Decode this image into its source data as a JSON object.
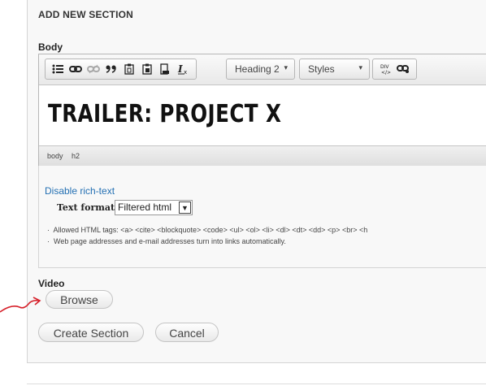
{
  "section": {
    "title": "ADD NEW SECTION"
  },
  "body_field": {
    "label": "Body",
    "toolbar": {
      "format_combo": "Heading 2",
      "styles_combo": "Styles",
      "icons": [
        "bulleted-list-icon",
        "link-icon",
        "unlink-icon",
        "blockquote-icon",
        "paste-text-icon",
        "paste-word-icon",
        "paste-icon",
        "remove-format-icon",
        "div-container-icon",
        "anchor-icon"
      ]
    },
    "content_heading": "TRAILER: PROJECT X",
    "element_path": [
      "body",
      "h2"
    ]
  },
  "format": {
    "disable_link": "Disable rich-text",
    "text_format_label": "Text format",
    "text_format_value": "Filtered html",
    "tips": [
      "Allowed HTML tags: <a> <cite> <blockquote> <code> <ul> <ol> <li> <dl> <dt> <dd> <p> <br> <h",
      "Web page addresses and e-mail addresses turn into links automatically."
    ]
  },
  "video_field": {
    "label": "Video",
    "browse_button": "Browse"
  },
  "actions": {
    "create_button": "Create Section",
    "cancel_button": "Cancel"
  },
  "colors": {
    "link": "#2470b3",
    "annotation_arrow": "#d6202a",
    "panel_bg": "#f8f8f8"
  }
}
